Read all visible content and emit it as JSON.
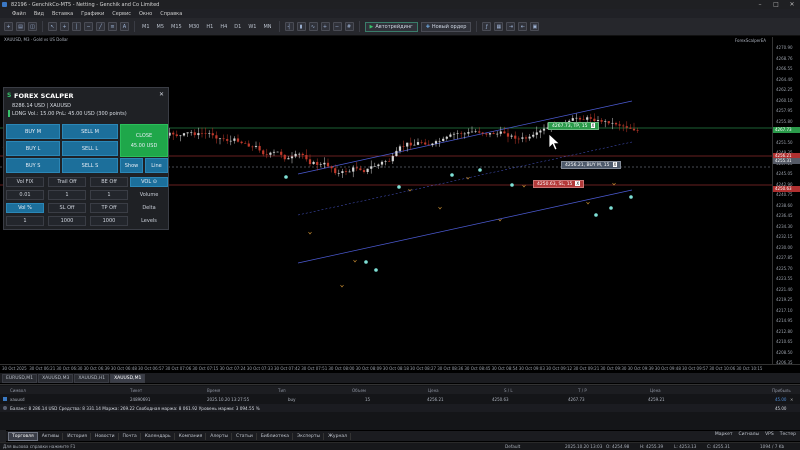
{
  "window": {
    "title": "82196 - GenchikCo-MT5 - Netting - Genchik and Co Limited",
    "controls": [
      "–",
      "□",
      "✕"
    ]
  },
  "menu": [
    "Файл",
    "Вид",
    "Вставка",
    "Графики",
    "Сервис",
    "Окно",
    "Справка"
  ],
  "toolbar": {
    "timeframes": [
      "M1",
      "M5",
      "M15",
      "M30",
      "H1",
      "H4",
      "D1",
      "W1",
      "MN"
    ],
    "algo_label": "Автотрейдинг",
    "new_order_label": "Новый ордер"
  },
  "chart": {
    "header": "XAUUSD, M3 · Gold vs US Dollar",
    "ea_label": "ForexScalperEA",
    "prices": [
      "4270.90",
      "4268.76",
      "4266.55",
      "4264.40",
      "4262.25",
      "4260.10",
      "4257.95",
      "4255.80",
      "4253.65",
      "4251.50",
      "4249.35",
      "4247.20",
      "4245.05",
      "4242.90",
      "4240.75",
      "4238.60",
      "4236.45",
      "4234.30",
      "4232.15",
      "4230.00",
      "4227.85",
      "4225.70",
      "4223.55",
      "4221.40",
      "4219.25",
      "4217.10",
      "4214.95",
      "4212.80",
      "4210.65",
      "4208.50",
      "4206.35"
    ],
    "price_tags": {
      "ask": "4256.21",
      "bid": "4255.31",
      "tp": "4267.73",
      "sl": "4250.63"
    },
    "times": [
      "30 Oct 2025",
      "30 Oct 06:21",
      "30 Oct 06:30",
      "30 Oct 06:39",
      "30 Oct 06:48",
      "30 Oct 06:57",
      "30 Oct 07:06",
      "30 Oct 07:15",
      "30 Oct 07:24",
      "30 Oct 07:33",
      "30 Oct 07:42",
      "30 Oct 07:51",
      "30 Oct 08:00",
      "30 Oct 08:09",
      "30 Oct 08:18",
      "30 Oct 08:27",
      "30 Oct 08:36",
      "30 Oct 08:45",
      "30 Oct 08:54",
      "30 Oct 09:03",
      "30 Oct 09:12",
      "30 Oct 09:21",
      "30 Oct 09:30",
      "30 Oct 09:39",
      "30 Oct 09:48",
      "30 Oct 09:57",
      "30 Oct 10:06",
      "30 Oct 10:15"
    ],
    "tp_label": "4267.73, TP, 15",
    "buy_label": "4256.21, BUY M, 15",
    "sl_label": "4250.63, SL, 15",
    "label_close": "X",
    "colors": {
      "bull": "#d6d6d6",
      "bear": "#c0392b",
      "channel": "#4c5bd4",
      "tp_line": "#39c26b",
      "sl_line": "#d04040",
      "entry": "#8f98a8"
    }
  },
  "chart_tabs": [
    "EURUSD,M1",
    "XAUUSD,M3",
    "XAUUSD,H1",
    "XAUUSD,M1"
  ],
  "scalper": {
    "title": "FOREX SCALPER",
    "logo": "S",
    "close_icon": "✕",
    "balance_line": "8286.14 USD | XAUUSD",
    "position_line": "LONG   Vol.: 15.00    PnL: 45.00 USD    (300 points)",
    "buy_m": "BUY M",
    "sell_m": "SELL M",
    "close": "CLOSE",
    "buy_l": "BUY L",
    "sell_l": "SELL L",
    "close_value": "45.00 USD",
    "buy_s": "BUY S",
    "sell_s": "SELL S",
    "show": "Show",
    "lines": "Line",
    "vol_fix": "Vol FIX",
    "trail_off": "Trail Off",
    "be_off": "BE Off",
    "vol_btn": "VOL ⊙",
    "v1": "0.01",
    "v2": "1",
    "v3": "1",
    "volume": "Volume",
    "vol_pct": "Vol %",
    "sl_off": "SL Off",
    "tp_off": "TP Off",
    "delta": "Delta",
    "l1": "1",
    "l2": "1000",
    "l3": "1000",
    "levels": "Levels"
  },
  "trade": {
    "headers": [
      "Символ",
      "Тикет",
      "Время",
      "Тип",
      "Объем",
      "Цена",
      "S / L",
      "T / P",
      "Цена",
      "Прибыль"
    ],
    "row": [
      "xauusd",
      "24890691",
      "2025.10.20 13:27:55",
      "buy",
      "15",
      "4256.21",
      "4250.63",
      "4267.73",
      "4259.21",
      "45.00"
    ],
    "balance": "Баланс: 8 286.14 USD   Средства: 8 331.14   Маржа: 269.22   Свободная маржа: 8 061.92   Уровень маржи: 3 094.55 %",
    "balance_profit": "45.00"
  },
  "bottom_tabs": [
    "Торговля",
    "Активы",
    "История",
    "Новости",
    "Почта",
    "Календарь",
    "Компания",
    "Алерты",
    "Статьи",
    "Библиотека",
    "Эксперты",
    "Журнал"
  ],
  "bottom_right": [
    "Маркет",
    "Сигналы",
    "VPS",
    "Тестер"
  ],
  "status": {
    "help": "Для вызова справки нажмите F1",
    "profile": "Default",
    "datetime": "2025.10.20 13:03",
    "o": "O: 4254.98",
    "h": "H: 4255.39",
    "l": "L: 4253.13",
    "c": "C: 4255.31",
    "conn": "1094 / 7 Kb"
  }
}
